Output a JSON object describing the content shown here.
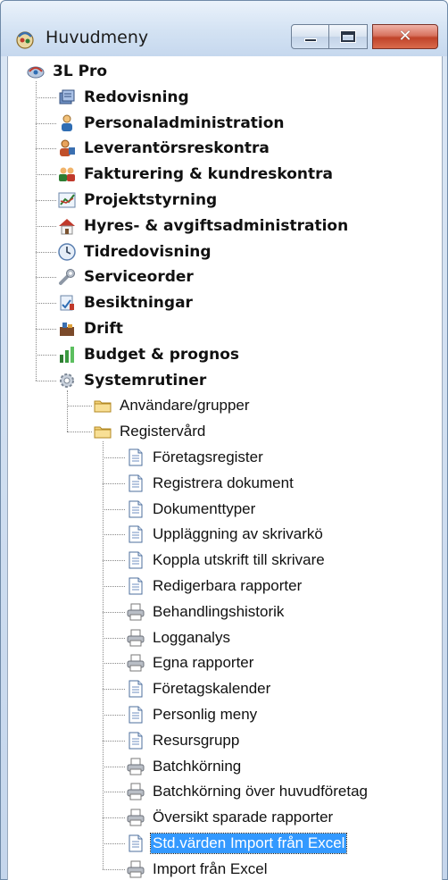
{
  "window": {
    "title": "Huvudmeny"
  },
  "tree": {
    "root": {
      "label": "3L Pro",
      "icon": "app-icon"
    },
    "modules": [
      {
        "label": "Redovisning",
        "icon": "ledger-icon"
      },
      {
        "label": "Personaladministration",
        "icon": "person-icon"
      },
      {
        "label": "Leverantörsreskontra",
        "icon": "supplier-icon"
      },
      {
        "label": "Fakturering & kundreskontra",
        "icon": "customers-icon"
      },
      {
        "label": "Projektstyrning",
        "icon": "project-chart-icon"
      },
      {
        "label": "Hyres- & avgiftsadministration",
        "icon": "house-icon"
      },
      {
        "label": "Tidredovisning",
        "icon": "clock-icon"
      },
      {
        "label": "Serviceorder",
        "icon": "wrench-icon"
      },
      {
        "label": "Besiktningar",
        "icon": "inspection-icon"
      },
      {
        "label": "Drift",
        "icon": "operations-icon"
      },
      {
        "label": "Budget & prognos",
        "icon": "bar-chart-icon"
      },
      {
        "label": "Systemrutiner",
        "icon": "gear-icon"
      }
    ],
    "system_folders": [
      {
        "label": "Användare/grupper",
        "icon": "folder-icon"
      },
      {
        "label": "Registervård",
        "icon": "folder-icon"
      }
    ],
    "register_items": [
      {
        "label": "Företagsregister",
        "icon": "document-icon"
      },
      {
        "label": "Registrera dokument",
        "icon": "document-icon"
      },
      {
        "label": "Dokumenttyper",
        "icon": "document-icon"
      },
      {
        "label": "Uppläggning av skrivarkö",
        "icon": "document-icon"
      },
      {
        "label": "Koppla utskrift till skrivare",
        "icon": "document-icon"
      },
      {
        "label": "Redigerbara rapporter",
        "icon": "document-icon"
      },
      {
        "label": "Behandlingshistorik",
        "icon": "printer-icon"
      },
      {
        "label": "Logganalys",
        "icon": "printer-icon"
      },
      {
        "label": "Egna rapporter",
        "icon": "printer-icon"
      },
      {
        "label": "Företagskalender",
        "icon": "document-icon"
      },
      {
        "label": "Personlig meny",
        "icon": "document-icon"
      },
      {
        "label": "Resursgrupp",
        "icon": "document-icon"
      },
      {
        "label": "Batchkörning",
        "icon": "printer-icon"
      },
      {
        "label": "Batchkörning över huvudföretag",
        "icon": "printer-icon"
      },
      {
        "label": "Översikt sparade rapporter",
        "icon": "printer-icon"
      },
      {
        "label": "Std.värden Import från Excel",
        "icon": "document-icon",
        "selected": true
      },
      {
        "label": "Import från Excel",
        "icon": "printer-icon"
      }
    ]
  },
  "colors": {
    "selection": "#3399ff",
    "title_bar": "#d3e2f3",
    "close_button": "#c0432a"
  }
}
